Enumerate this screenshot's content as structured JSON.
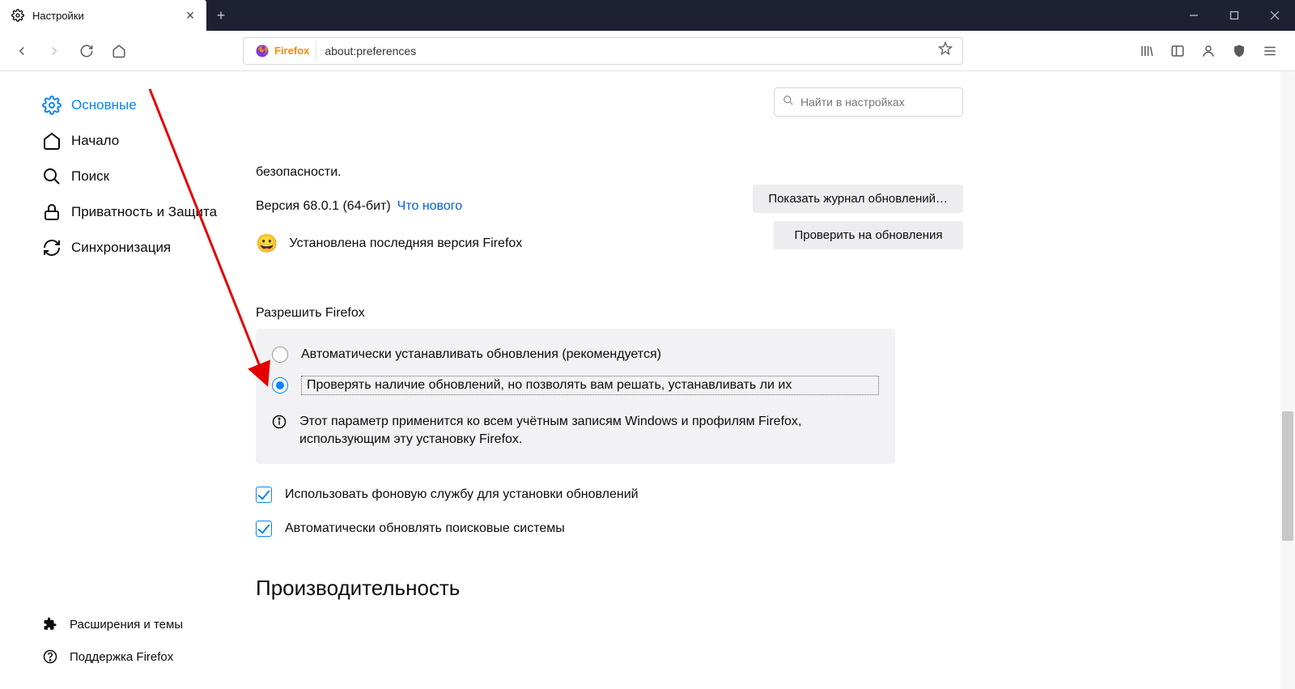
{
  "tab": {
    "title": "Настройки"
  },
  "urlbar": {
    "identity": "Firefox",
    "value": "about:preferences"
  },
  "search": {
    "placeholder": "Найти в настройках"
  },
  "sidebar": {
    "items": [
      {
        "label": "Основные"
      },
      {
        "label": "Начало"
      },
      {
        "label": "Поиск"
      },
      {
        "label": "Приватность и Защита"
      },
      {
        "label": "Синхронизация"
      }
    ],
    "footer": [
      {
        "label": "Расширения и темы"
      },
      {
        "label": "Поддержка Firefox"
      }
    ]
  },
  "content": {
    "partial_text": "безопасности.",
    "version_prefix": "Версия 68.0.1 (64-бит)",
    "whats_new": "Что нового",
    "status": "Установлена последняя версия Firefox",
    "btn_history": "Показать журнал обновлений…",
    "btn_check": "Проверить на обновления",
    "allow_heading": "Разрешить Firefox",
    "radio_auto": "Автоматически устанавливать обновления (рекомендуется)",
    "radio_check": "Проверять наличие обновлений, но позволять вам решать, устанавливать ли их",
    "info": "Этот параметр применится ко всем учётным записям Windows и профилям Firefox, использующим эту установку Firefox.",
    "chk_bg": "Использовать фоновую службу для установки обновлений",
    "chk_search": "Автоматически обновлять поисковые системы",
    "perf_heading": "Производительность"
  }
}
